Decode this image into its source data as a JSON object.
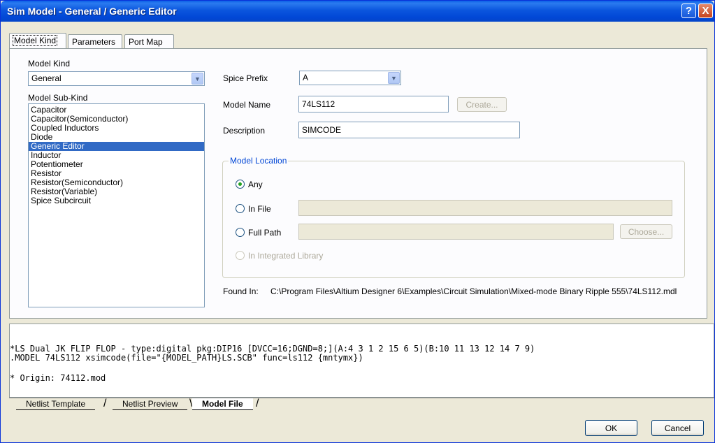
{
  "window": {
    "title": "Sim Model - General / Generic Editor",
    "help_glyph": "?",
    "close_glyph": "X"
  },
  "tabs": [
    "Model Kind",
    "Parameters",
    "Port Map"
  ],
  "model_kind": {
    "label": "Model Kind",
    "value": "General",
    "sub_kind_label": "Model Sub-Kind",
    "sub_kinds": [
      "Capacitor",
      "Capacitor(Semiconductor)",
      "Coupled Inductors",
      "Diode",
      "Generic Editor",
      "Inductor",
      "Potentiometer",
      "Resistor",
      "Resistor(Semiconductor)",
      "Resistor(Variable)",
      "Spice Subcircuit"
    ],
    "selected_sub_kind": "Generic Editor"
  },
  "spice_prefix": {
    "label": "Spice Prefix",
    "value": "A"
  },
  "model_name": {
    "label": "Model Name",
    "value": "74LS112",
    "create_label": "Create..."
  },
  "description": {
    "label": "Description",
    "value": "SIMCODE"
  },
  "model_location": {
    "title": "Model Location",
    "options": {
      "any": "Any",
      "in_file": "In File",
      "full_path": "Full Path",
      "integrated": "In Integrated Library"
    },
    "selected": "Any",
    "choose_label": "Choose..."
  },
  "found_in": {
    "label": "Found In:",
    "path": "C:\\Program Files\\Altium Designer 6\\Examples\\Circuit Simulation\\Mixed-mode Binary Ripple 555\\74LS112.mdl"
  },
  "model_file": {
    "lines": [
      "*LS Dual JK FLIP FLOP - type:digital pkg:DIP16 [DVCC=16;DGND=8;](A:4 3 1 2 15 6 5)(B:10 11 13 12 14 7 9)",
      ".MODEL 74LS112 xsimcode(file=\"{MODEL_PATH}LS.SCB\" func=ls112 {mntymx})",
      "* Origin: 74112.mod"
    ]
  },
  "bottom_tabs": [
    "Netlist Template",
    "Netlist Preview",
    "Model File"
  ],
  "active_bottom_tab": "Model File",
  "buttons": {
    "ok": "OK",
    "cancel": "Cancel"
  }
}
